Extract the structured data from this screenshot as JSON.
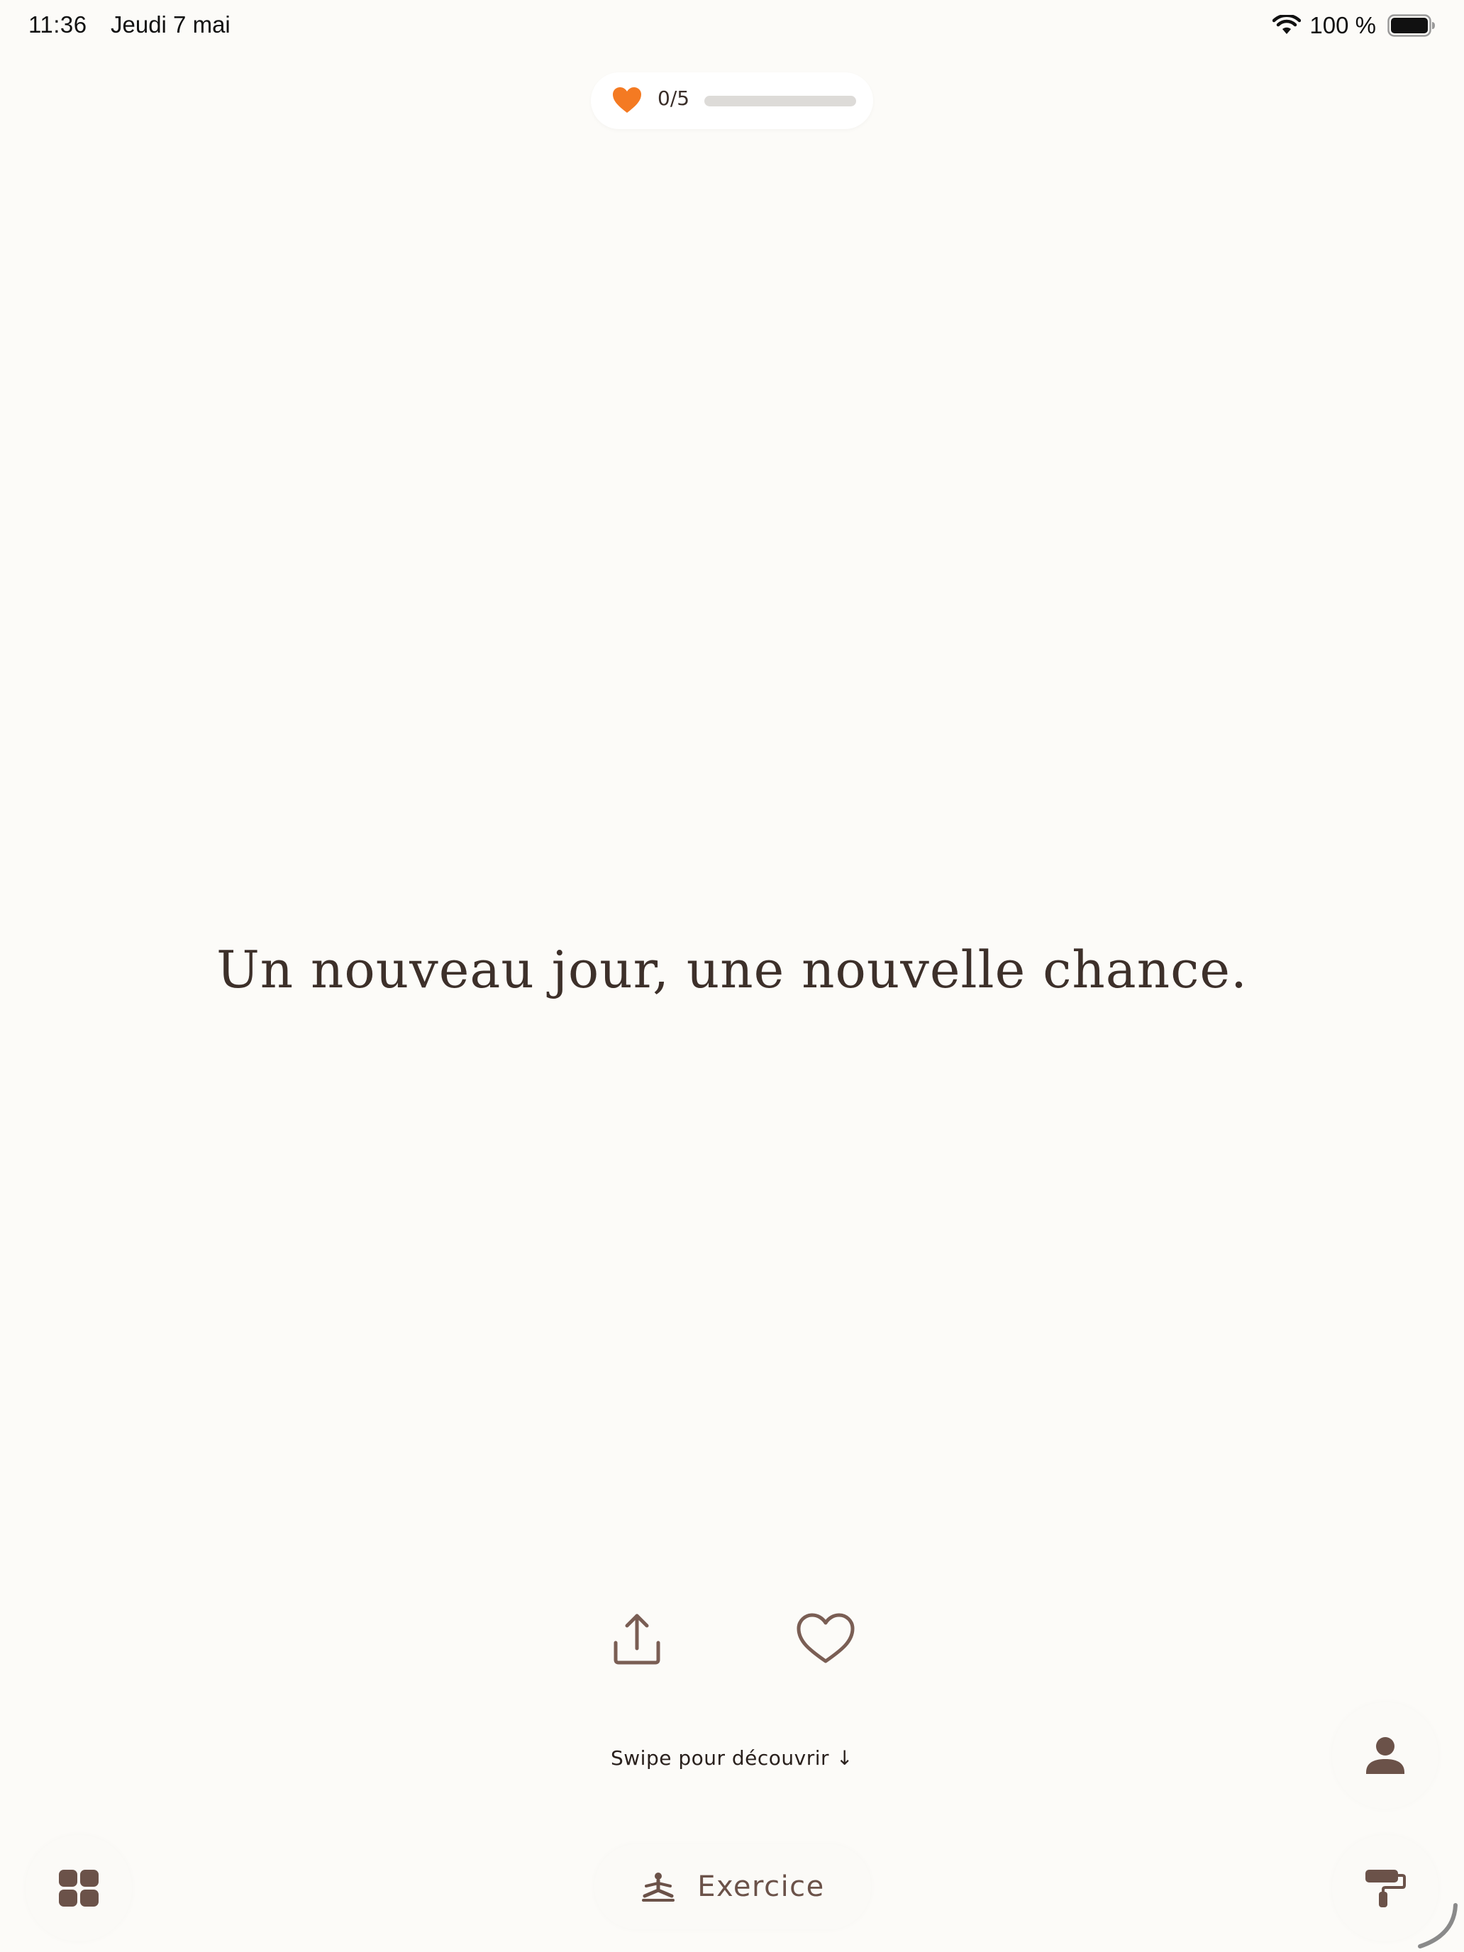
{
  "status_bar": {
    "time": "11:36",
    "date": "Jeudi 7 mai",
    "battery_text": "100 %",
    "icons": [
      "wifi-icon",
      "battery-icon"
    ]
  },
  "progress": {
    "count_label": "0/5",
    "fraction": 0,
    "icon": "heart-filled-icon",
    "accent_color": "#f47a22"
  },
  "quote": {
    "text": "Un nouveau jour, une nouvelle chance."
  },
  "actions": {
    "share_icon": "share-icon",
    "like_icon": "heart-outline-icon"
  },
  "swipe_hint": {
    "text": "Swipe pour découvrir",
    "arrow": "↓"
  },
  "bottom_bar": {
    "exercise_label": "Exercice",
    "exercise_icon": "meditation-icon",
    "menu_icon": "grid-icon",
    "profile_icon": "person-icon",
    "theme_icon": "paint-roller-icon"
  },
  "colors": {
    "background": "#fcfbf8",
    "icon_brown": "#6b5249",
    "text_dark": "#3d302a"
  }
}
